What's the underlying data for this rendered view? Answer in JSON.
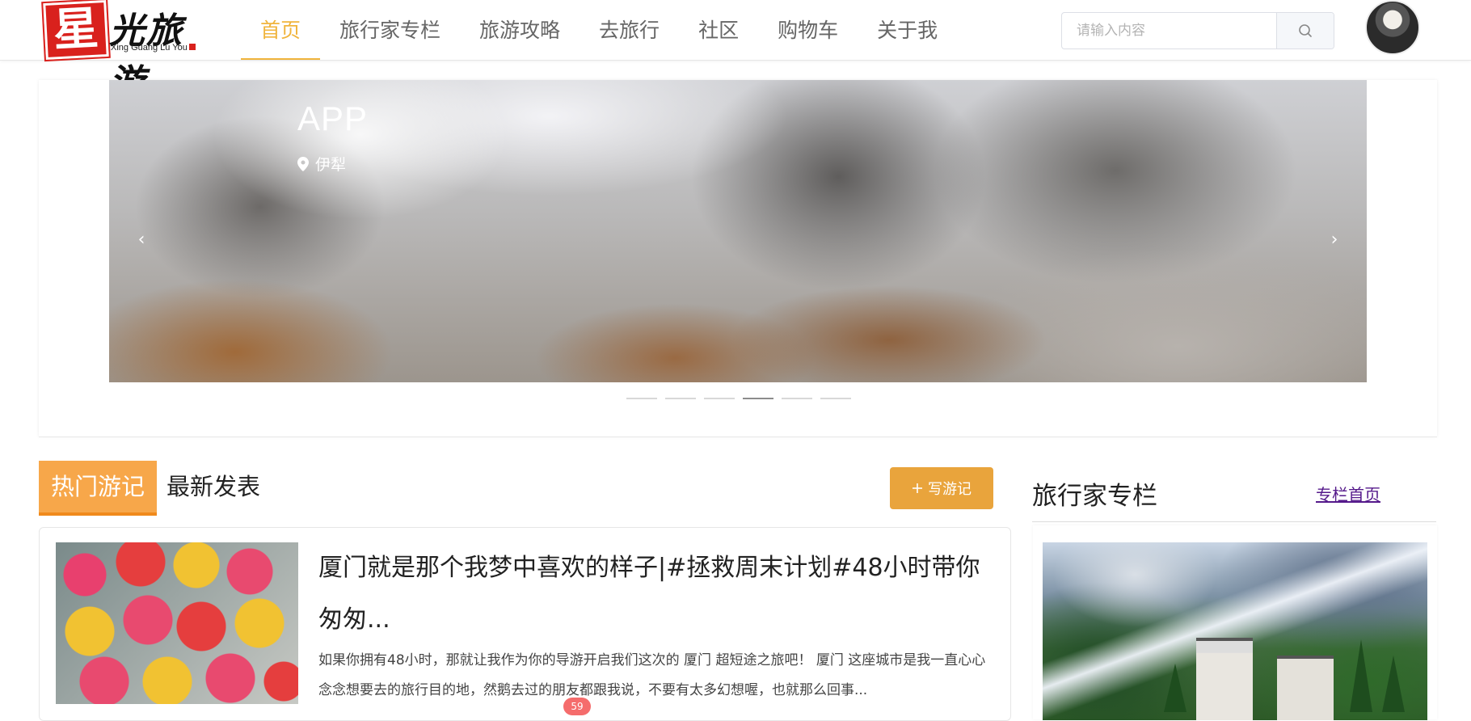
{
  "header": {
    "logo": {
      "mark": "星",
      "name": "光旅游",
      "sub": "Xing Guang Lu You"
    },
    "nav": [
      {
        "label": "首页",
        "active": true
      },
      {
        "label": "旅行家专栏",
        "active": false
      },
      {
        "label": "旅游攻略",
        "active": false
      },
      {
        "label": "去旅行",
        "active": false
      },
      {
        "label": "社区",
        "active": false
      },
      {
        "label": "购物车",
        "active": false
      },
      {
        "label": "关于我",
        "active": false
      }
    ],
    "search": {
      "placeholder": "请输入内容",
      "value": ""
    },
    "colors": {
      "accent": "#f0b43c",
      "brand_red": "#d9211d"
    }
  },
  "carousel": {
    "slide_title": "APP",
    "slide_location": "伊犁",
    "prev_icon": "chevron-left-icon",
    "next_icon": "chevron-right-icon",
    "prev_glyph": "‹",
    "next_glyph": "›",
    "dot_count": 6,
    "active_dot": 4
  },
  "section": {
    "tab_hot": "热门游记",
    "tab_new": "最新发表",
    "write_button": "写游记",
    "colors": {
      "tab_hot_bg": "#f7a74a",
      "write_bg": "#e9a43c"
    }
  },
  "article": {
    "title": "厦门就是那个我梦中喜欢的样子|#拯救周末计划#48小时带你匆匆...",
    "description": "如果你拥有48小时，那就让我作为你的导游开启我们这次的 厦门 超短途之旅吧！ 厦门 这座城市是我一直心心念念想要去的旅行目的地，然鹅去过的朋友都跟我说，不要有太多幻想喔，也就那么回事...",
    "badge": "59"
  },
  "sidebar": {
    "title": "旅行家专栏",
    "link": "专栏首页"
  }
}
